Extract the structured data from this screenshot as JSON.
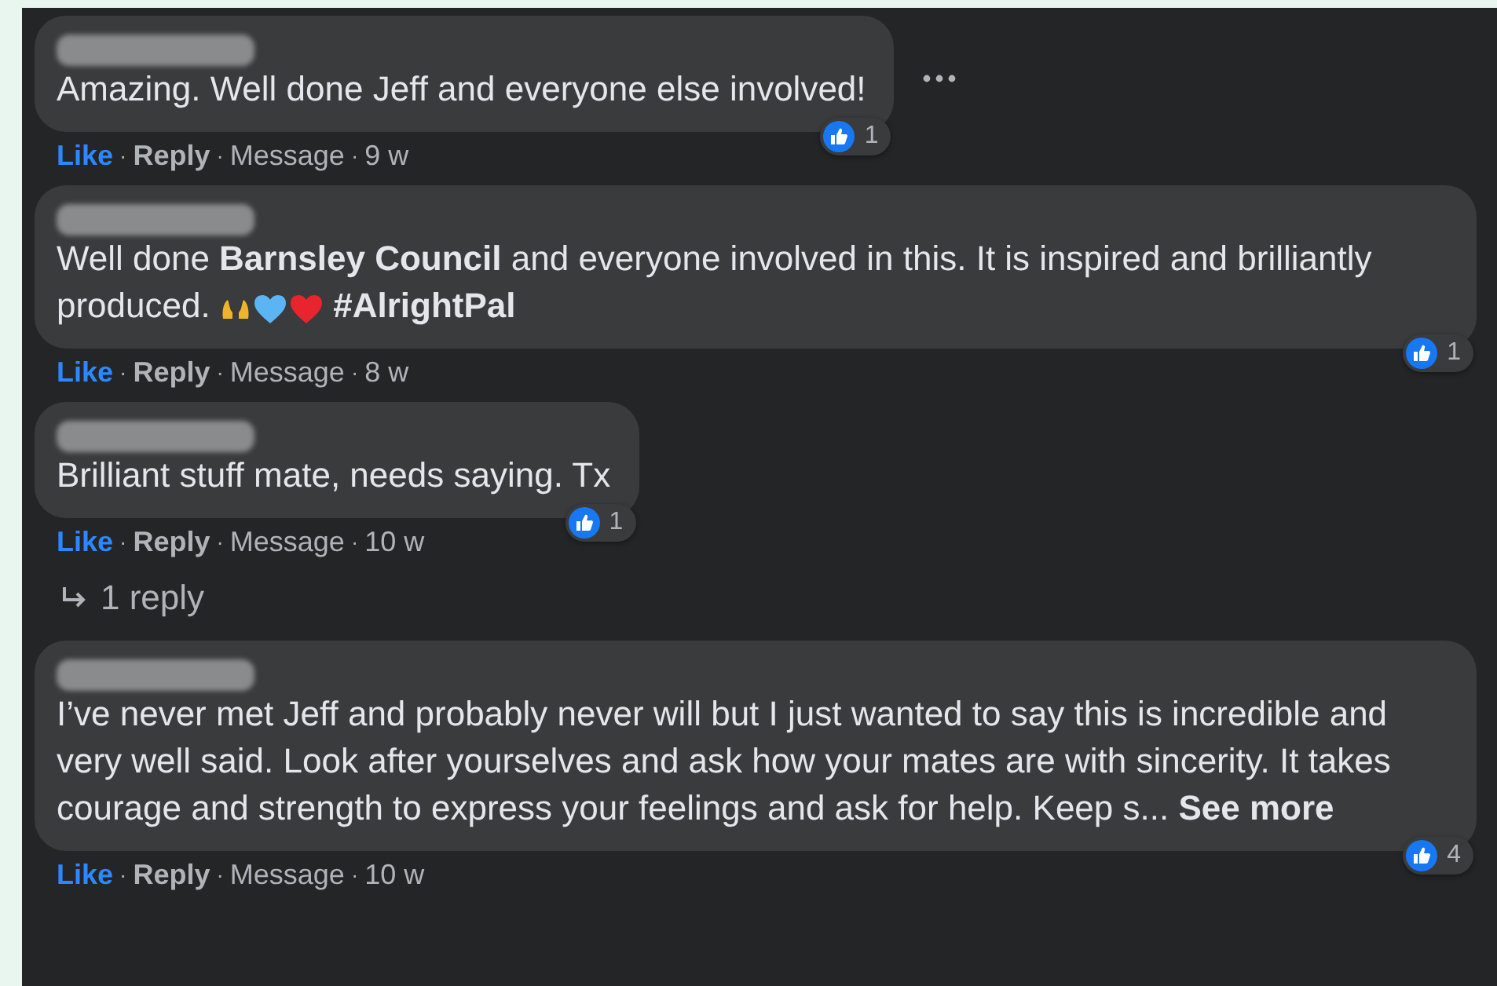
{
  "comments": [
    {
      "menu_visible": true,
      "parts": [
        {
          "kind": "text",
          "text": "Amazing. Well done Jeff and everyone else involved!"
        }
      ],
      "reaction_count": "1",
      "actions": [
        {
          "kind": "like",
          "text": "Like",
          "liked": true
        },
        {
          "kind": "sep",
          "text": "·"
        },
        {
          "kind": "reply",
          "text": "Reply"
        },
        {
          "kind": "sep",
          "text": "·"
        },
        {
          "kind": "plain",
          "text": "Message"
        },
        {
          "kind": "sep",
          "text": "·"
        },
        {
          "kind": "plain",
          "text": "9 w"
        }
      ]
    },
    {
      "menu_visible": false,
      "parts": [
        {
          "kind": "text",
          "text": "Well done **Barnsley Council** and everyone involved in this. It is inspired and brilliantly produced."
        },
        {
          "kind": "emojis"
        },
        {
          "kind": "text",
          "text": "**#AlrightPal**"
        }
      ],
      "reaction_count": "1",
      "actions": [
        {
          "kind": "like",
          "text": "Like",
          "liked": true
        },
        {
          "kind": "sep",
          "text": "·"
        },
        {
          "kind": "reply",
          "text": "Reply"
        },
        {
          "kind": "sep",
          "text": "·"
        },
        {
          "kind": "plain",
          "text": "Message"
        },
        {
          "kind": "sep",
          "text": "·"
        },
        {
          "kind": "plain",
          "text": "8 w"
        }
      ]
    },
    {
      "menu_visible": false,
      "parts": [
        {
          "kind": "text",
          "text": "Brilliant stuff mate, needs saying. Tx"
        }
      ],
      "reaction_count": "1",
      "actions": [
        {
          "kind": "like",
          "text": "Like",
          "liked": true
        },
        {
          "kind": "sep",
          "text": "·"
        },
        {
          "kind": "reply",
          "text": "Reply"
        },
        {
          "kind": "sep",
          "text": "·"
        },
        {
          "kind": "plain",
          "text": "Message"
        },
        {
          "kind": "sep",
          "text": "·"
        },
        {
          "kind": "plain",
          "text": "10 w"
        }
      ],
      "replies_link": "1 reply"
    },
    {
      "menu_visible": false,
      "parts": [
        {
          "kind": "text",
          "text": "I’ve never met Jeff and probably never will but I just wanted to say this is incredible and very well said. Look after yourselves and ask how your mates are with sincerity. It takes courage and strength to express your feelings and ask for help. Keep s..."
        },
        {
          "kind": "link",
          "text": "See more"
        }
      ],
      "reaction_count": "4",
      "actions": [
        {
          "kind": "like",
          "text": "Like",
          "liked": true
        },
        {
          "kind": "sep",
          "text": "·"
        },
        {
          "kind": "reply",
          "text": "Reply"
        },
        {
          "kind": "sep",
          "text": "·"
        },
        {
          "kind": "plain",
          "text": "Message"
        },
        {
          "kind": "sep",
          "text": "·"
        },
        {
          "kind": "plain",
          "text": "10 w"
        }
      ]
    }
  ]
}
